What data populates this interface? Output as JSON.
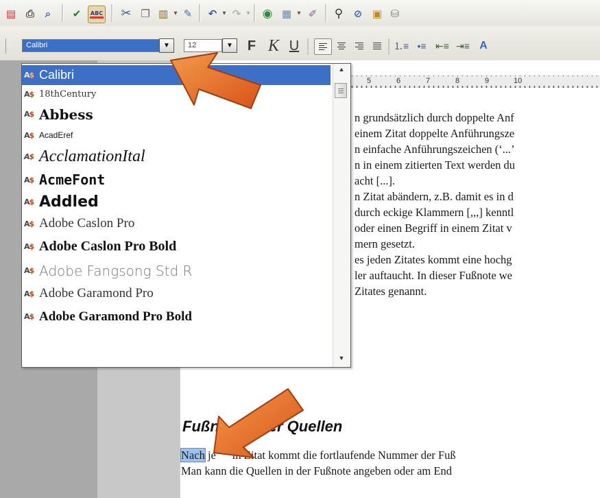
{
  "font_toolbar": {
    "font_name": "Calibri",
    "font_size": "12",
    "bold_label": "F",
    "italic_label": "K",
    "underline_label": "U"
  },
  "ruler": {
    "numbers": [
      "5",
      "6",
      "7",
      "8",
      "9",
      "10"
    ]
  },
  "font_list": {
    "items": [
      {
        "label": "Calibri",
        "selected": true
      },
      {
        "label": "18thCentury",
        "selected": false
      },
      {
        "label": "Abbess",
        "selected": false
      },
      {
        "label": "AcadEref",
        "selected": false
      },
      {
        "label": "AcclamationItal",
        "selected": false
      },
      {
        "label": "AcmeFont",
        "selected": false
      },
      {
        "label": "Addled",
        "selected": false
      },
      {
        "label": "Adobe Caslon Pro",
        "selected": false
      },
      {
        "label": "Adobe Caslon Pro Bold",
        "selected": false
      },
      {
        "label": "Adobe Fangsong Std R",
        "selected": false
      },
      {
        "label": "Adobe Garamond Pro",
        "selected": false
      },
      {
        "label": "Adobe Garamond Pro Bold",
        "selected": false
      }
    ]
  },
  "document": {
    "paragraph_lines": [
      "n grundsätzlich durch doppelte Anf",
      "einem Zitat doppelte Anführungsze",
      "n einfache Anführungszeichen (‘...’",
      "n in einem zitierten Text werden du",
      "acht [...].",
      "n Zitat abändern, z.B. damit es in d",
      "durch eckige Klammern [,,,] kenntl",
      " oder einen Begriff in einem Zitat v",
      "mern gesetzt.",
      "es jeden Zitates kommt eine hochg",
      "ler auftaucht. In dieser Fußnote we",
      " Zitates genannt."
    ],
    "heading_start": "Fußn",
    "heading_end": "er Quellen",
    "line1_selected": "Nach",
    "line1_rest_partial": "je",
    "line1_rest": "m Zitat kommt die fortlaufende Nummer der Fuß",
    "line2": "Man kann die Quellen in der Fußnote angeben oder am End"
  },
  "icons": {
    "toolbar1": [
      "export-pdf-icon",
      "print-icon",
      "page-preview-icon",
      "spellcheck-icon",
      "autospellcheck-icon",
      "cut-icon",
      "copy-icon",
      "paste-icon",
      "clone-formatting-icon",
      "undo-icon",
      "redo-icon",
      "hyperlink-icon",
      "table-icon",
      "draw-functions-icon",
      "find-replace-icon",
      "navigator-icon",
      "gallery-icon",
      "data-sources-icon"
    ],
    "toolbar2": [
      "numbering-icon",
      "bullets-icon",
      "decrease-indent-icon",
      "increase-indent-icon",
      "character-highlight-icon"
    ]
  },
  "colors": {
    "selection": "#3c6fc6",
    "arrow": "#e8641e",
    "arrow_dark": "#b8440c"
  }
}
